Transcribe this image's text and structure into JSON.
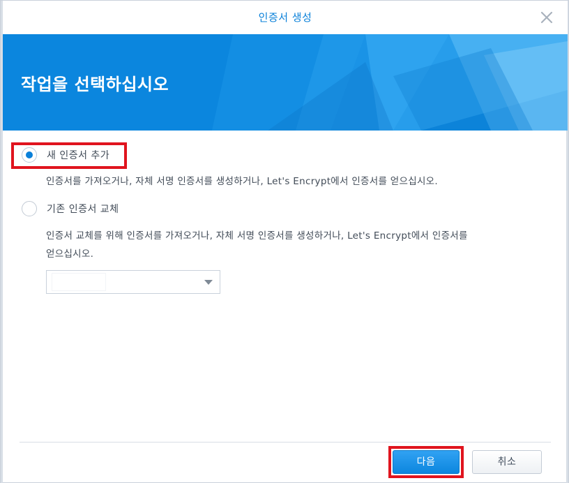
{
  "dialog": {
    "title": "인증서 생성",
    "heading": "작업을 선택하십시오"
  },
  "options": [
    {
      "label": "새 인증서 추가",
      "selected": true,
      "description": "인증서를 가져오거나, 자체 서명 인증서를 생성하거나, Let's Encrypt에서 인증서를 얻으십시오."
    },
    {
      "label": "기존 인증서 교체",
      "selected": false,
      "description_line1": "인증서 교체를 위해 인증서를 가져오거나, 자체 서명 인증서를 생성하거나, Let's Encrypt에서 인증서를",
      "description_line2": "얻으십시오."
    }
  ],
  "certificate_select": {
    "value": ""
  },
  "footer": {
    "next_label": "다음",
    "cancel_label": "취소"
  },
  "colors": {
    "accent": "#0a80d9",
    "banner": "#0b86de",
    "highlight": "#e0141e"
  }
}
